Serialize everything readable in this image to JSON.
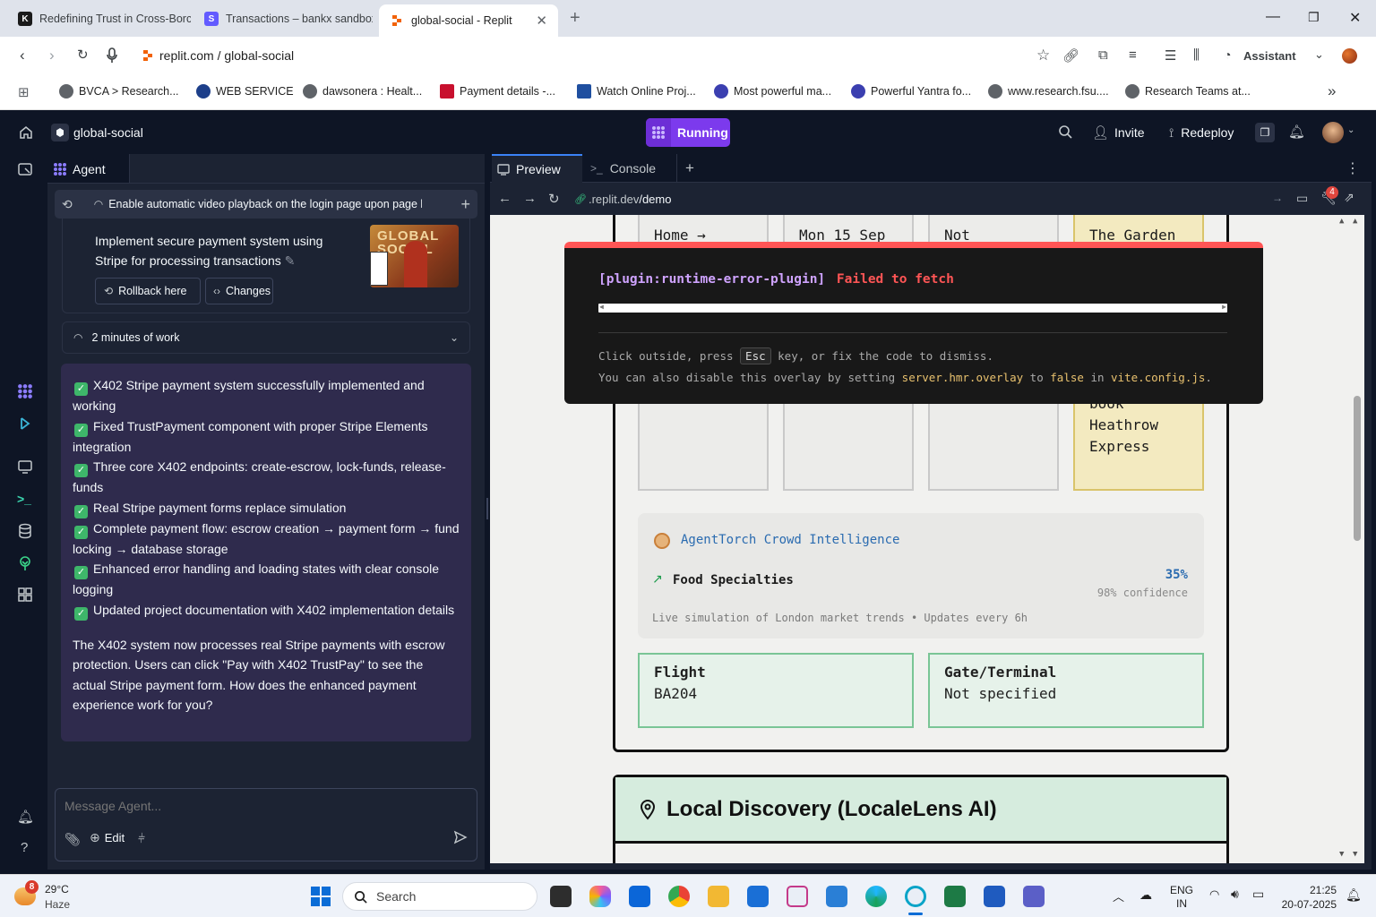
{
  "browser": {
    "tabs": [
      {
        "title": "Redefining Trust in Cross-Borc",
        "icon_letter": "K",
        "icon_color": "#1a1a1a"
      },
      {
        "title": "Transactions – bankx sandbox",
        "icon_letter": "S",
        "icon_color": "#635bff"
      },
      {
        "title": "global-social - Replit",
        "icon_letter": "",
        "icon_color": "#f26207"
      }
    ],
    "address": "replit.com / global-social",
    "assistant_label": "Assistant",
    "bookmarks": [
      {
        "label": "BVCA > Research...",
        "color": "#5f6368"
      },
      {
        "label": "WEB SERVICE",
        "color": "#1d3f8a"
      },
      {
        "label": "dawsonera : Healt...",
        "color": "#5f6368"
      },
      {
        "label": "Payment details -...",
        "color": "#c8102e"
      },
      {
        "label": "Watch Online Proj...",
        "color": "#1f4fa0"
      },
      {
        "label": "Most powerful ma...",
        "color": "#3b3fb0"
      },
      {
        "label": "Powerful Yantra fo...",
        "color": "#3b3fb0"
      },
      {
        "label": "www.research.fsu....",
        "color": "#5f6368"
      },
      {
        "label": "Research Teams at...",
        "color": "#5f6368"
      }
    ]
  },
  "replit": {
    "project_name": "global-social",
    "run_status": "Running",
    "invite_label": "Invite",
    "redeploy_label": "Redeploy",
    "agent_tab": "Agent",
    "agent_header_title": "Enable automatic video playback on the login page upon page l...",
    "checkpoint": {
      "title": "Implement secure payment system using Stripe for processing transactions",
      "thumb_text": "GLOBAL SOCIAL",
      "rollback_label": "Rollback here",
      "changes_label": "Changes"
    },
    "work_summary": "2 minutes of work",
    "agent_message": {
      "items": [
        "X402 Stripe payment system successfully implemented and working",
        "Fixed TrustPayment component with proper Stripe Elements integration",
        "Three core X402 endpoints: create-escrow, lock-funds, release-funds",
        "Real Stripe payment forms replace simulation",
        "Complete payment flow: escrow creation → payment form → fund locking → database storage",
        "Enhanced error handling and loading states with clear console logging",
        "Updated project documentation with X402 implementation details"
      ],
      "summary": "The X402 system now processes real Stripe payments with escrow protection. Users can click \"Pay with X402 TrustPay\" to see the actual Stripe payment form. How does the enhanced payment experience work for you?"
    },
    "input_placeholder": "Message Agent...",
    "edit_label": "Edit",
    "preview_tab": "Preview",
    "console_tab": "Console",
    "preview_url_prefix": ".replit.dev",
    "preview_url_path": "/demo",
    "notif_count": "4"
  },
  "app": {
    "top_cells": [
      "Home →",
      "Mon 15 Sep",
      "Not",
      "The Garden"
    ],
    "cell4_lines": [
      "book",
      "Heathrow",
      "Express"
    ],
    "agenttorch_title": "AgentTorch Crowd Intelligence",
    "trend_label": "Food Specialties",
    "trend_percent": "35%",
    "trend_confidence": "98% confidence",
    "trend_footer": "Live simulation of London market trends • Updates every 6h",
    "flight_label": "Flight",
    "flight_value": "BA204",
    "gate_label": "Gate/Terminal",
    "gate_value": "Not specified",
    "local_discovery_title": "Local Discovery (LocaleLens AI)"
  },
  "overlay": {
    "plugin": "[plugin:runtime-error-plugin]",
    "message": "Failed to fetch",
    "line1_a": "Click outside, press",
    "line1_key": "Esc",
    "line1_b": "key, or fix the code to dismiss.",
    "line2_a": "You can also disable this overlay by setting",
    "line2_code1": "server.hmr.overlay",
    "line2_b": "to",
    "line2_code2": "false",
    "line2_c": "in",
    "line2_code3": "vite.config.js",
    "line2_d": "."
  },
  "taskbar": {
    "weather_badge": "8",
    "temperature": "29°C",
    "condition": "Haze",
    "search_placeholder": "Search",
    "lang_1": "ENG",
    "lang_2": "IN",
    "time": "21:25",
    "date": "20-07-2025"
  }
}
